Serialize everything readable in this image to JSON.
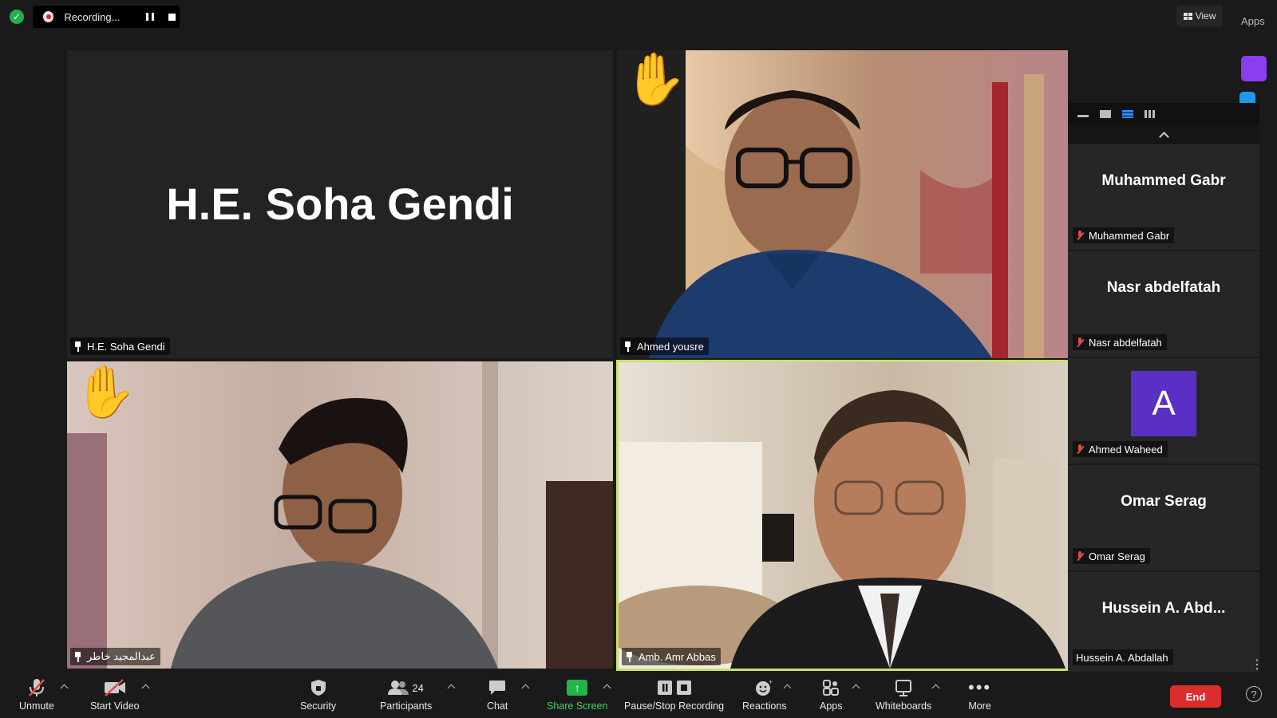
{
  "recording": {
    "status": "Recording..."
  },
  "topbar": {
    "view_label": "View",
    "apps_label": "Apps"
  },
  "tiles": [
    {
      "name": "H.E. Soha Gendi",
      "display_name": "H.E. Soha Gendi"
    },
    {
      "name": "Ahmed yousre"
    },
    {
      "name": "عبدالمجيد خاطر"
    },
    {
      "name": "Amb. Amr Abbas"
    }
  ],
  "side_panel": {
    "participants": [
      {
        "big_name": "Muhammed Gabr",
        "label": "Muhammed Gabr"
      },
      {
        "big_name": "Nasr abdelfatah",
        "label": "Nasr abdelfatah"
      },
      {
        "avatar_letter": "A",
        "label": "Ahmed Waheed"
      },
      {
        "big_name": "Omar Serag",
        "label": "Omar Serag"
      },
      {
        "big_name": "Hussein A. Abd...",
        "label": "Hussein A. Abdallah"
      }
    ]
  },
  "toolbar": {
    "unmute": "Unmute",
    "start_video": "Start Video",
    "security": "Security",
    "participants": "Participants",
    "participants_count": "24",
    "chat": "Chat",
    "share_screen": "Share Screen",
    "pause_stop_recording": "Pause/Stop Recording",
    "reactions": "Reactions",
    "apps": "Apps",
    "whiteboards": "Whiteboards",
    "more": "More",
    "end": "End"
  },
  "colors": {
    "active_speaker_border": "#c7e06a",
    "end_button": "#dc2d2d",
    "share_green": "#25b34b",
    "avatar_purple": "#5a2fc4"
  }
}
